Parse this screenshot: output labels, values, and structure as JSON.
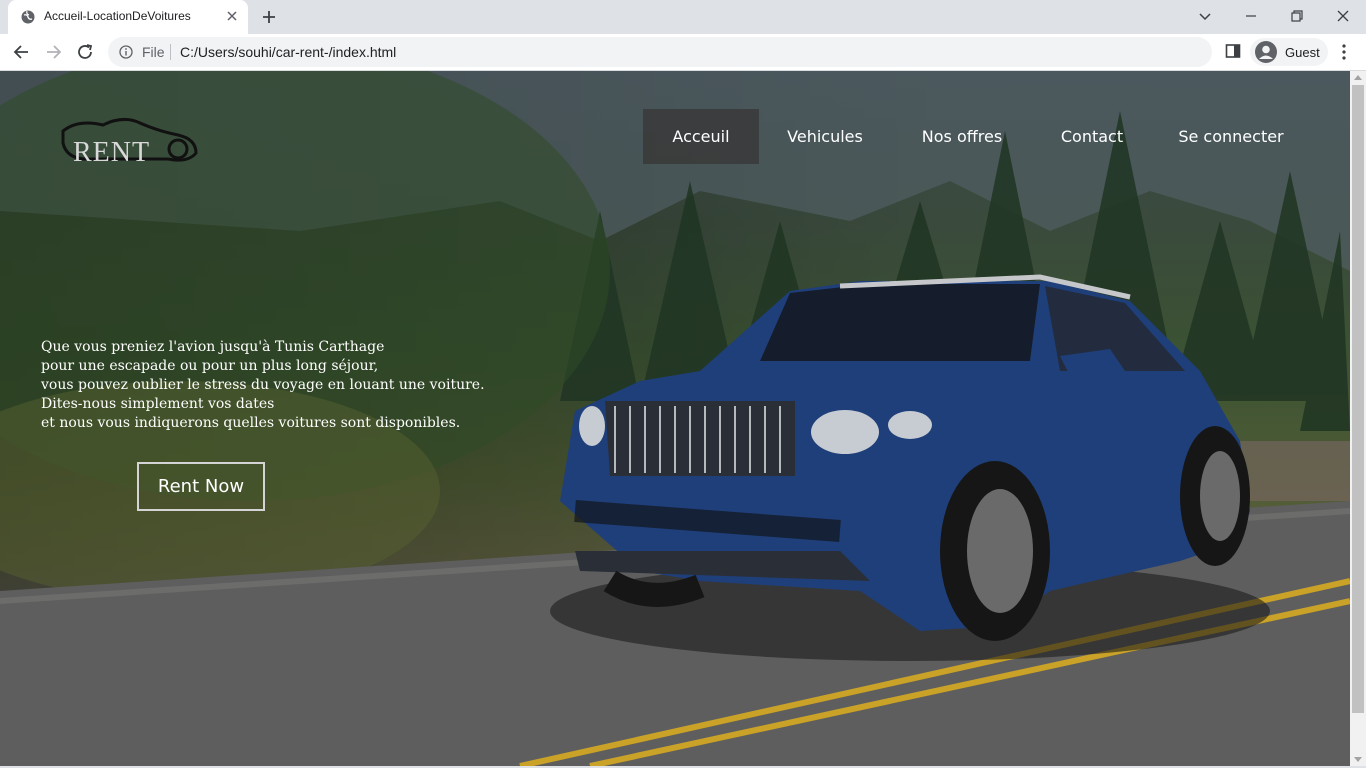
{
  "browser": {
    "tab_title": "Accueil-LocationDeVoitures",
    "address": {
      "scheme_label": "File",
      "url": "C:/Users/souhi/car-rent-/index.html"
    },
    "profile_label": "Guest"
  },
  "site": {
    "logo_text": "RENT",
    "nav": [
      {
        "label": "Acceuil",
        "active": true
      },
      {
        "label": "Vehicules",
        "active": false
      },
      {
        "label": "Nos offres",
        "active": false
      },
      {
        "label": "Contact",
        "active": false
      },
      {
        "label": "Se connecter",
        "active": false
      }
    ],
    "tagline": [
      "Que vous preniez l'avion jusqu'à Tunis Carthage",
      "pour une escapade ou pour un plus long séjour,",
      "vous pouvez oublier le stress du voyage en louant une voiture.",
      "Dites-nous simplement vos dates",
      "et nous vous indiquerons quelles voitures sont disponibles."
    ],
    "cta_label": "Rent Now",
    "hero_image": "blue-suv-on-forest-road"
  },
  "colors": {
    "nav_active_bg": "#3a3a3a",
    "road_line": "#c9a227",
    "car_body": "#1f3f7a"
  }
}
